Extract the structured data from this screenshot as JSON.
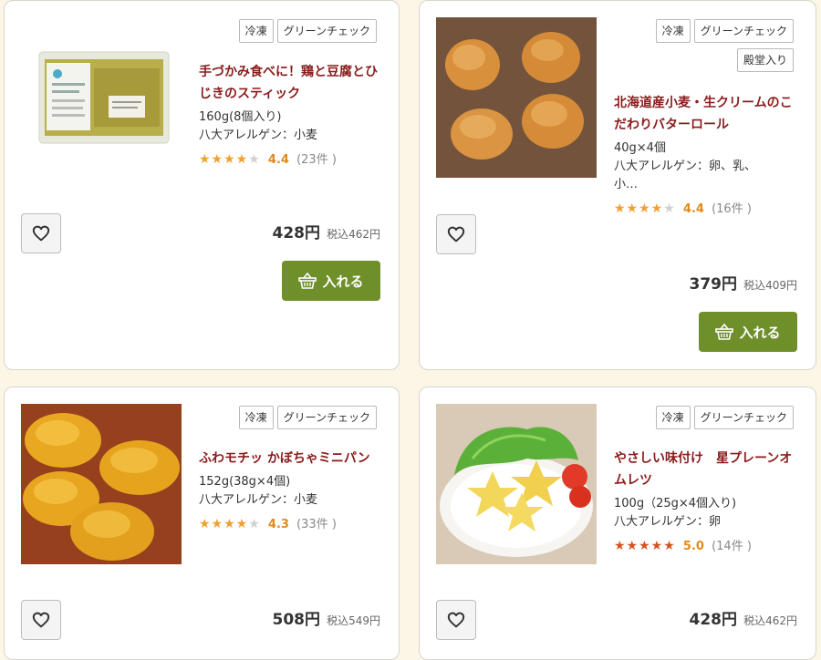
{
  "products": [
    {
      "tags": [
        "冷凍",
        "グリーンチェック"
      ],
      "title": "手づかみ食べに！鶏と豆腐とひじきのスティック",
      "weight": "160g(8個入り)",
      "allergen": "八大アレルゲン：小麦",
      "stars": "★★★★",
      "stars_off": "★",
      "rating": "4.4",
      "reviews": "(23件 )",
      "price": "428円",
      "tax_price": "税込462円",
      "cart_label": "入れる"
    },
    {
      "tags": [
        "冷凍",
        "グリーンチェック",
        "殿堂入り"
      ],
      "title": "北海道産小麦・生クリームのこだわりバターロール",
      "weight": "40g×4個",
      "allergen": "八大アレルゲン：卵、乳、小…",
      "stars": "★★★★",
      "stars_off": "★",
      "rating": "4.4",
      "reviews": "(16件 )",
      "price": "379円",
      "tax_price": "税込409円",
      "cart_label": "入れる"
    },
    {
      "tags": [
        "冷凍",
        "グリーンチェック"
      ],
      "title": "ふわモチッ かぼちゃミニパン",
      "weight": "152g(38g×4個)",
      "allergen": "八大アレルゲン：小麦",
      "stars": "★★★★",
      "stars_off": "★",
      "rating": "4.3",
      "reviews": "(33件 )",
      "price": "508円",
      "tax_price": "税込549円"
    },
    {
      "tags": [
        "冷凍",
        "グリーンチェック"
      ],
      "title": "やさしい味付け　星プレーンオムレツ",
      "weight": "100g（25g×4個入り)",
      "allergen": "八大アレルゲン：卵",
      "stars": "★★★★★",
      "stars_off": "",
      "rating": "5.0",
      "reviews": "(14件 )",
      "price": "428円",
      "tax_price": "税込462円"
    }
  ],
  "icons": {
    "favorite": "heart-outline-icon",
    "cart": "basket-icon"
  },
  "colors": {
    "title": "#8a1b1b",
    "cart_button": "#6f8f2b",
    "star": "#f0a030",
    "star_full_red": "#d4531e",
    "page_bg": "#fbf6e6"
  }
}
